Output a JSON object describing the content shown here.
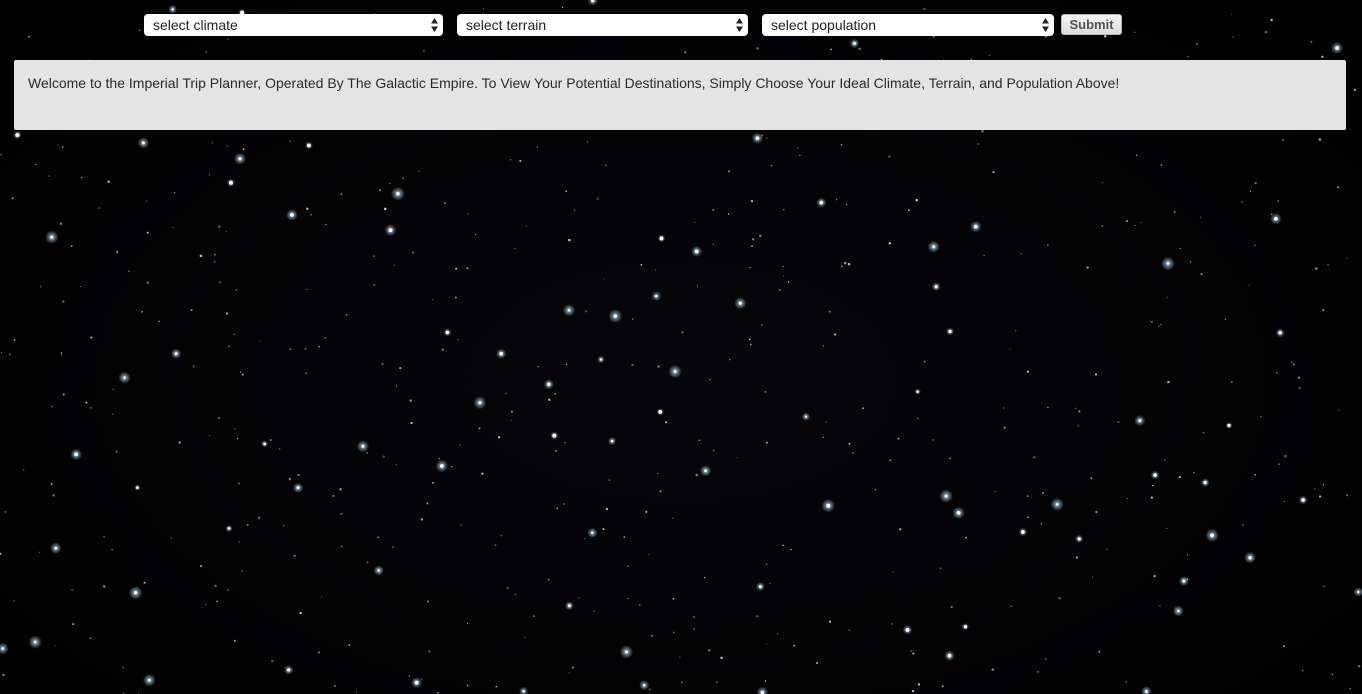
{
  "filters": {
    "climate": {
      "selected": "select climate"
    },
    "terrain": {
      "selected": "select terrain"
    },
    "population": {
      "selected": "select population"
    }
  },
  "submit_label": "Submit",
  "welcome_message": "Welcome to the Imperial Trip Planner, Operated By The Galactic Empire. To View Your Potential Destinations, Simply Choose Your Ideal Climate, Terrain, and Population Above!",
  "colors": {
    "background": "#020203",
    "panel": "#e4e4e4",
    "star": "#ffffff",
    "star_glow": "#bfe3ff"
  }
}
